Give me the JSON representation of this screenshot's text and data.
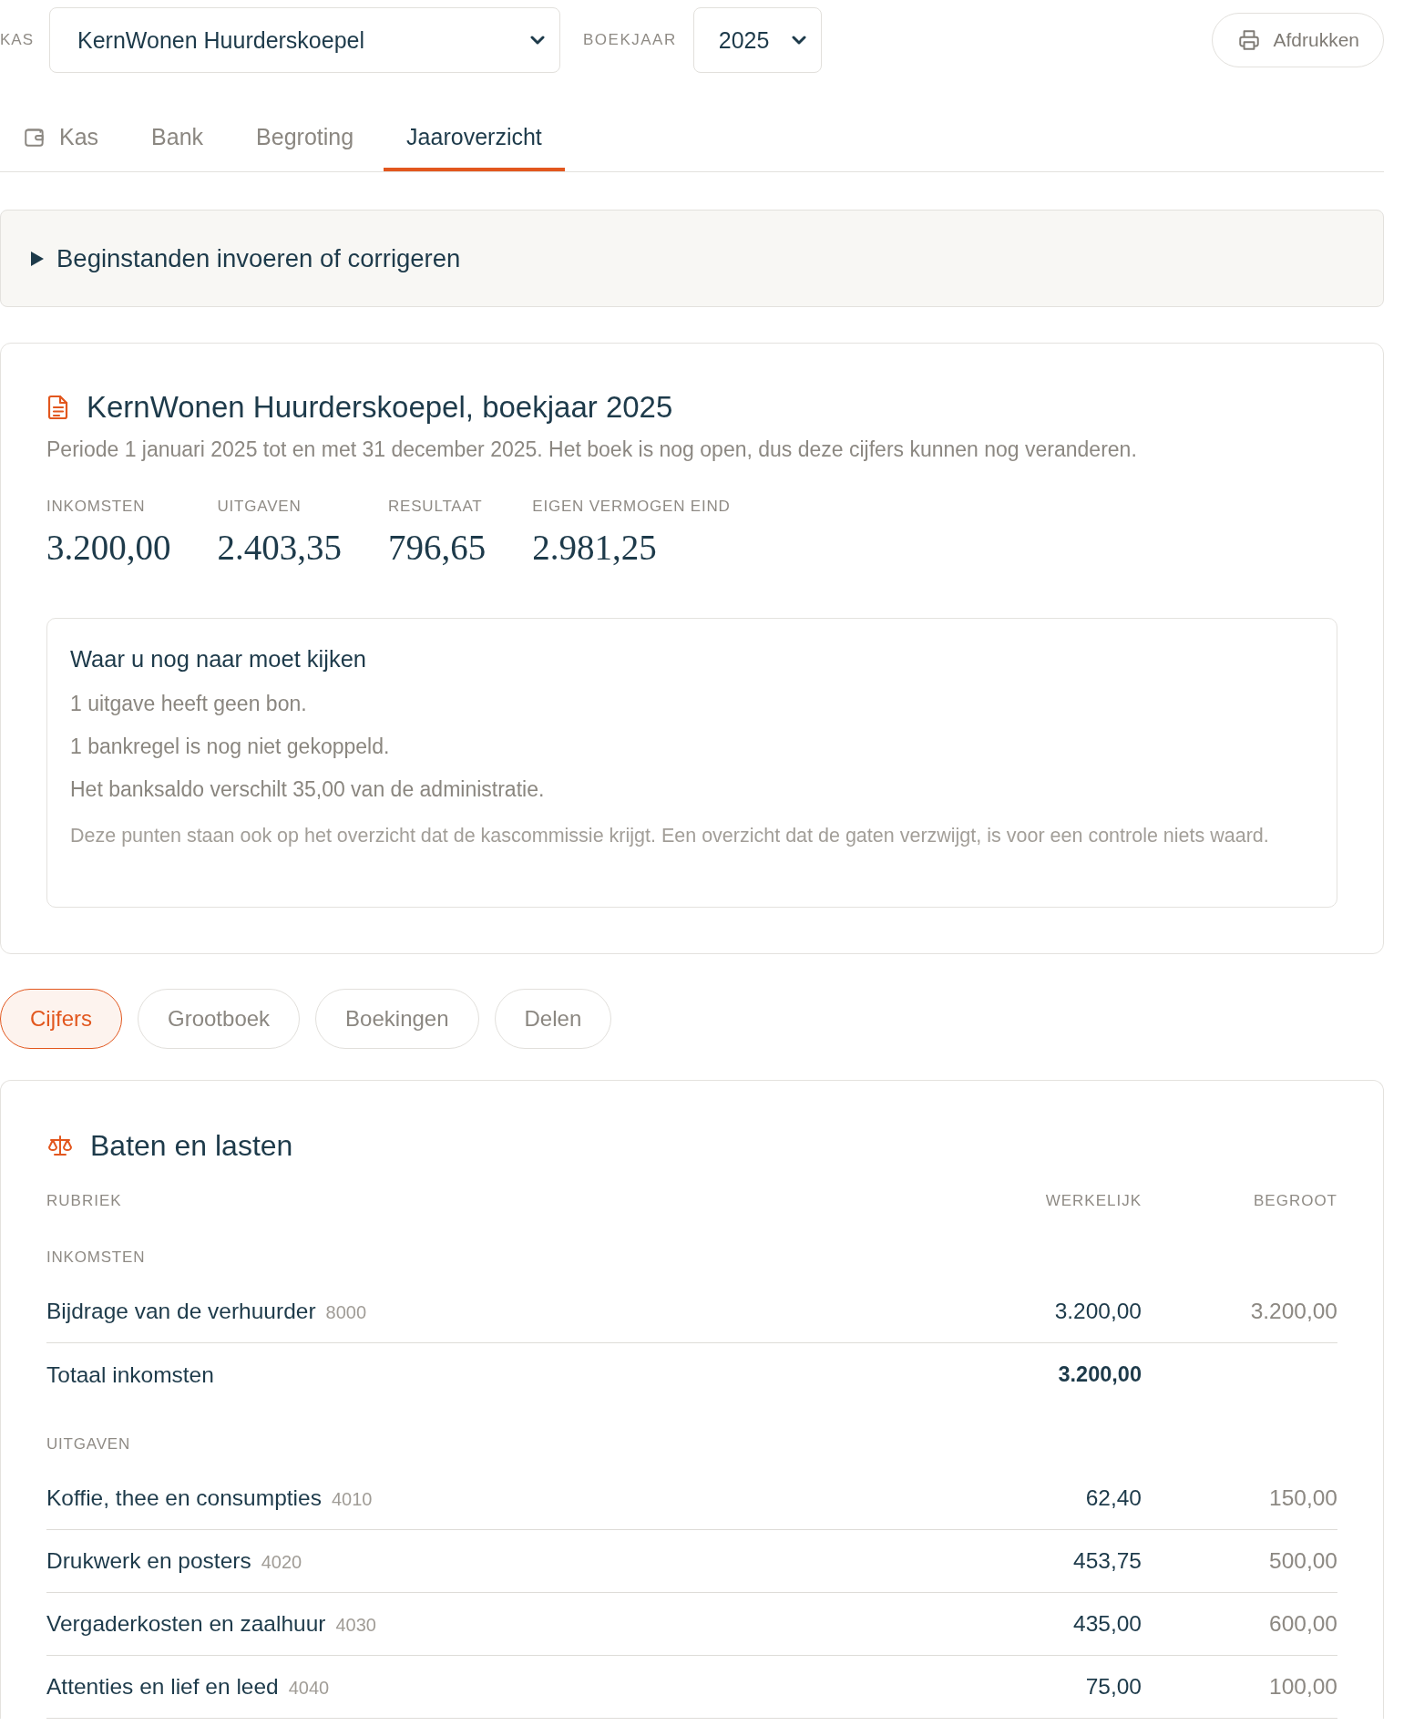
{
  "toolbar": {
    "kas_label": "KAS",
    "kas_select": "KernWonen Huurderskoepel",
    "year_label": "BOEKJAAR",
    "year_select": "2025",
    "print_button": "Afdrukken"
  },
  "tabs": [
    {
      "label": "Kas",
      "has_icon": true,
      "selected": false
    },
    {
      "label": "Bank",
      "has_icon": false,
      "selected": false
    },
    {
      "label": "Begroting",
      "has_icon": false,
      "selected": false
    },
    {
      "label": "Jaaroverzicht",
      "has_icon": false,
      "selected": true
    }
  ],
  "details": {
    "label": "Beginstanden invoeren of corrigeren",
    "expanded": false
  },
  "summary": {
    "title": "KernWonen Huurderskoepel, boekjaar 2025",
    "period": "Periode 1 januari 2025 tot en met 31 december 2025. Het boek is nog open, dus deze cijfers kunnen nog veranderen.",
    "stats": [
      {
        "label": "INKOMSTEN",
        "value": "3.200,00"
      },
      {
        "label": "UITGAVEN",
        "value": "2.403,35"
      },
      {
        "label": "RESULTAAT",
        "value": "796,65"
      },
      {
        "label": "EIGEN VERMOGEN EIND",
        "value": "2.981,25"
      }
    ],
    "checklist": {
      "title": "Waar u nog naar moet kijken",
      "items": [
        "1 uitgave heeft geen bon.",
        "1 bankregel is nog niet gekoppeld.",
        "Het banksaldo verschilt 35,00 van de administratie."
      ],
      "note": "Deze punten staan ook op het overzicht dat de kascommissie krijgt. Een overzicht dat de gaten verzwijgt, is voor een controle niets waard."
    }
  },
  "view_pills": [
    {
      "label": "Cijfers",
      "selected": true
    },
    {
      "label": "Grootboek",
      "selected": false
    },
    {
      "label": "Boekingen",
      "selected": false
    },
    {
      "label": "Delen",
      "selected": false
    }
  ],
  "statement": {
    "title": "Baten en lasten",
    "columns": [
      "RUBRIEK",
      "WERKELIJK",
      "BEGROOT"
    ],
    "groups": [
      {
        "label": "INKOMSTEN",
        "rows": [
          {
            "kind": "line",
            "name": "Bijdrage van de verhuurder",
            "code": "8000",
            "actual": "3.200,00",
            "budget": "3.200,00"
          },
          {
            "kind": "total",
            "name": "Totaal inkomsten",
            "actual": "3.200,00"
          }
        ]
      },
      {
        "label": "UITGAVEN",
        "rows": [
          {
            "kind": "line",
            "name": "Koffie, thee en consumpties",
            "code": "4010",
            "actual": "62,40",
            "budget": "150,00"
          },
          {
            "kind": "line",
            "name": "Drukwerk en posters",
            "code": "4020",
            "actual": "453,75",
            "budget": "500,00"
          },
          {
            "kind": "line",
            "name": "Vergaderkosten en zaalhuur",
            "code": "4030",
            "actual": "435,00",
            "budget": "600,00"
          },
          {
            "kind": "line",
            "name": "Attenties en lief en leed",
            "code": "4040",
            "actual": "75,00",
            "budget": "100,00"
          }
        ]
      }
    ]
  }
}
